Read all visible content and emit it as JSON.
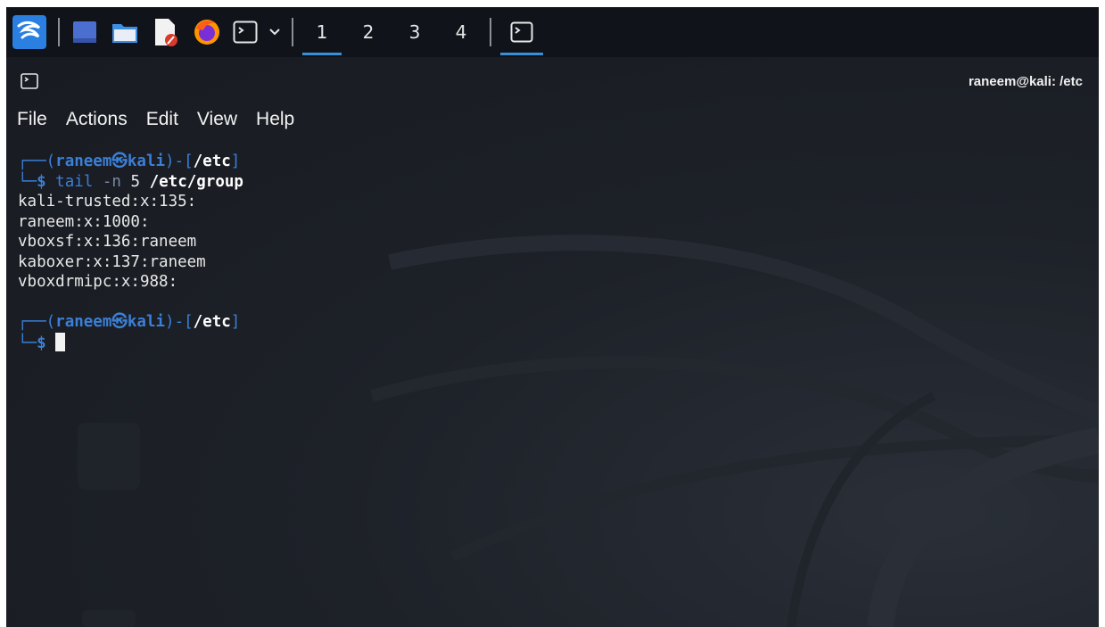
{
  "taskbar": {
    "icons": [
      {
        "name": "kali-menu-icon"
      },
      {
        "name": "show-desktop-icon"
      },
      {
        "name": "file-manager-icon"
      },
      {
        "name": "text-editor-icon"
      },
      {
        "name": "firefox-icon"
      },
      {
        "name": "terminal-launcher-icon"
      },
      {
        "name": "dropdown-chevron-icon"
      }
    ],
    "workspaces": [
      "1",
      "2",
      "3",
      "4"
    ],
    "active_workspace": "1",
    "accent": "#3a8fd6"
  },
  "window": {
    "title": "raneem@kali: /etc"
  },
  "menu": {
    "file": "File",
    "actions": "Actions",
    "edit": "Edit",
    "view": "View",
    "help": "Help"
  },
  "terminal": {
    "prompt1": {
      "open": "┌──(",
      "user": "raneem",
      "at": "㉿",
      "host": "kali",
      "mid": ")-[",
      "dir": "/etc",
      "close": "]",
      "corner": "└─",
      "dollar": "$",
      "cmd": "tail",
      "flag": "-n",
      "num": "5",
      "path": "/etc/group"
    },
    "output": [
      "kali-trusted:x:135:",
      "raneem:x:1000:",
      "vboxsf:x:136:raneem",
      "kaboxer:x:137:raneem",
      "vboxdrmipc:x:988:"
    ],
    "prompt2": {
      "open": "┌──(",
      "user": "raneem",
      "at": "㉿",
      "host": "kali",
      "mid": ")-[",
      "dir": "/etc",
      "close": "]",
      "corner": "└─",
      "dollar": "$"
    }
  }
}
